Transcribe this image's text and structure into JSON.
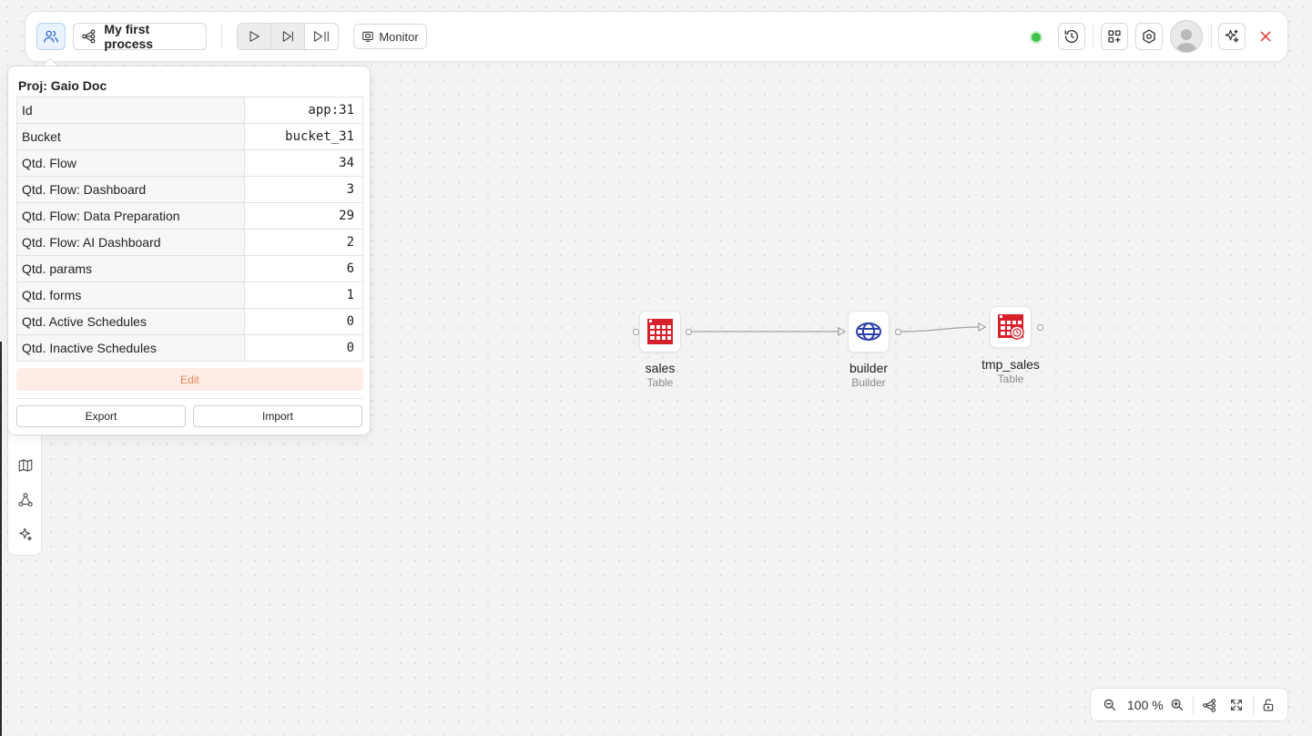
{
  "toolbar": {
    "process_name": "My first process",
    "monitor_label": "Monitor",
    "status_color": "#3ec24d",
    "icons": [
      "project-users-icon",
      "flow-icon",
      "play-icon",
      "step-forward-icon",
      "play-pause-icon",
      "monitor-icon",
      "history-icon",
      "apps-add-icon",
      "settings-icon",
      "user-avatar-icon",
      "ai-sparkle-icon",
      "close-icon"
    ]
  },
  "project_popover": {
    "title": "Proj: Gaio Doc",
    "rows": [
      {
        "key": "Id",
        "value": "app:31"
      },
      {
        "key": "Bucket",
        "value": "bucket_31"
      },
      {
        "key": "Qtd. Flow",
        "value": "34"
      },
      {
        "key": "Qtd. Flow: Dashboard",
        "value": "3"
      },
      {
        "key": "Qtd. Flow: Data Preparation",
        "value": "29"
      },
      {
        "key": "Qtd. Flow: AI Dashboard",
        "value": "2"
      },
      {
        "key": "Qtd. params",
        "value": "6"
      },
      {
        "key": "Qtd. forms",
        "value": "1"
      },
      {
        "key": "Qtd. Active Schedules",
        "value": "0"
      },
      {
        "key": "Qtd. Inactive Schedules",
        "value": "0"
      }
    ],
    "edit_label": "Edit",
    "export_label": "Export",
    "import_label": "Import",
    "edit_color": "#e58755"
  },
  "left_bar": {
    "icons": [
      "map-icon",
      "graph-nodes-icon",
      "sparkle-icon"
    ]
  },
  "flow": {
    "nodes": [
      {
        "name": "sales",
        "type": "Table",
        "icon": "table-icon"
      },
      {
        "name": "builder",
        "type": "Builder",
        "icon": "builder-icon"
      },
      {
        "name": "tmp_sales",
        "type": "Table",
        "icon": "temp-table-icon"
      }
    ],
    "table_color": "#d6202b",
    "builder_color": "#2b3fa8"
  },
  "zoom": {
    "level": "100 %"
  }
}
